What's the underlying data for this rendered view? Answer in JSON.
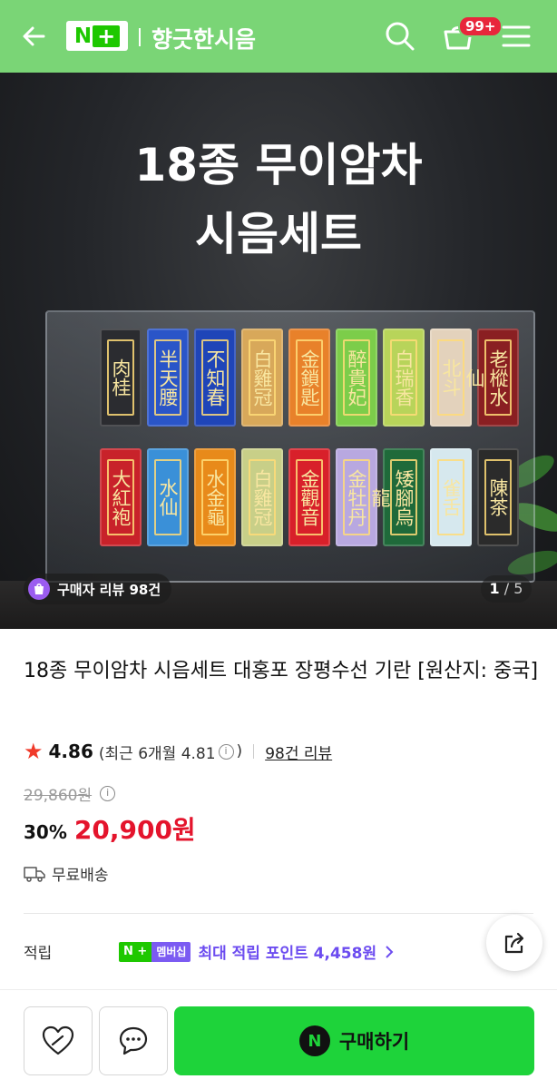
{
  "header": {
    "store_name": "향긋한시음",
    "cart_badge": "99+",
    "logo_n": "N",
    "logo_plus": "+"
  },
  "hero": {
    "title_line1": "18종 무이암차",
    "title_line2": "시음세트",
    "review_pill": "구매자 리뷰 98건",
    "page_current": "1",
    "page_total": "/ 5",
    "packets_top": [
      {
        "text": "肉桂",
        "color": "#2b2c30"
      },
      {
        "text": "半天腰",
        "color": "#2a55c8"
      },
      {
        "text": "不知春",
        "color": "#1f45b8"
      },
      {
        "text": "白雞冠",
        "color": "#d8a85a"
      },
      {
        "text": "金鎖匙",
        "color": "#e8812a"
      },
      {
        "text": "醉貴妃",
        "color": "#7ccd4a"
      },
      {
        "text": "白瑞香",
        "color": "#b8d45a"
      },
      {
        "text": "北斗",
        "color": "#e3d2bc"
      },
      {
        "text": "老樅水仙",
        "color": "#8a1f22"
      }
    ],
    "packets_bottom": [
      {
        "text": "大紅袍",
        "color": "#c8222a"
      },
      {
        "text": "水仙",
        "color": "#3a90d8"
      },
      {
        "text": "水金龜",
        "color": "#e88a1a"
      },
      {
        "text": "白雞冠",
        "color": "#c8cf88"
      },
      {
        "text": "金觀音",
        "color": "#d8202a"
      },
      {
        "text": "金牡丹",
        "color": "#b8a8e0"
      },
      {
        "text": "矮腳烏龍",
        "color": "#1f6a3a"
      },
      {
        "text": "雀舌",
        "color": "#d6e8ee"
      },
      {
        "text": "陳茶",
        "color": "#2b2b2b"
      }
    ]
  },
  "product": {
    "title": "18종 무이암차 시음세트 대홍포 장평수선 기란 [원산지: 중국]",
    "rating": "4.86",
    "recent_open": "(최근 6개월 4.81",
    "recent_close": ")",
    "review_link": "98건 리뷰",
    "original_price": "29,860원",
    "discount_rate": "30%",
    "sale_price": "20,900원",
    "shipping": "무료배송",
    "points_label": "적립",
    "np_badge_n": "N +",
    "np_badge_member": "멤버십",
    "points_text": "최대 적립 포인트 4,458원"
  },
  "bottom_bar": {
    "buy_label": "구매하기",
    "buy_icon_letter": "N"
  },
  "colors": {
    "header_green": "#7ad576",
    "naver_green": "#1ec800",
    "buy_green": "#1ed33a",
    "price_red": "#e4142c",
    "member_purple": "#6c4cf0"
  }
}
